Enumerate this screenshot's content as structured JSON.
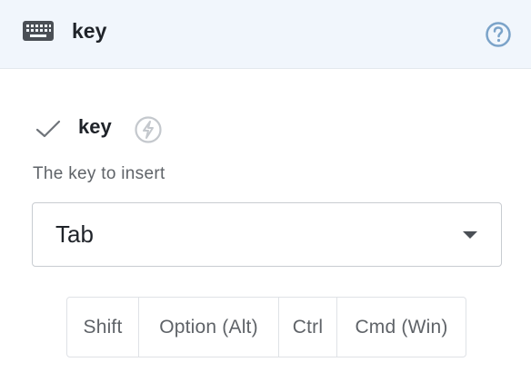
{
  "header": {
    "title": "key",
    "keyboard_icon": "keyboard-icon",
    "help_icon": "help-circle-icon"
  },
  "parameter": {
    "name": "key",
    "status_icon": "check-icon",
    "dynamic_icon": "lightning-bolt-icon",
    "description": "The key to insert"
  },
  "select": {
    "value": "Tab"
  },
  "modifiers": [
    {
      "label": "Shift"
    },
    {
      "label": "Option (Alt)"
    },
    {
      "label": "Ctrl"
    },
    {
      "label": "Cmd (Win)"
    }
  ],
  "colors": {
    "header_bg": "#f1f6fc",
    "accent": "#7ba3c9",
    "text": "#1f2329",
    "muted": "#5f6368"
  }
}
